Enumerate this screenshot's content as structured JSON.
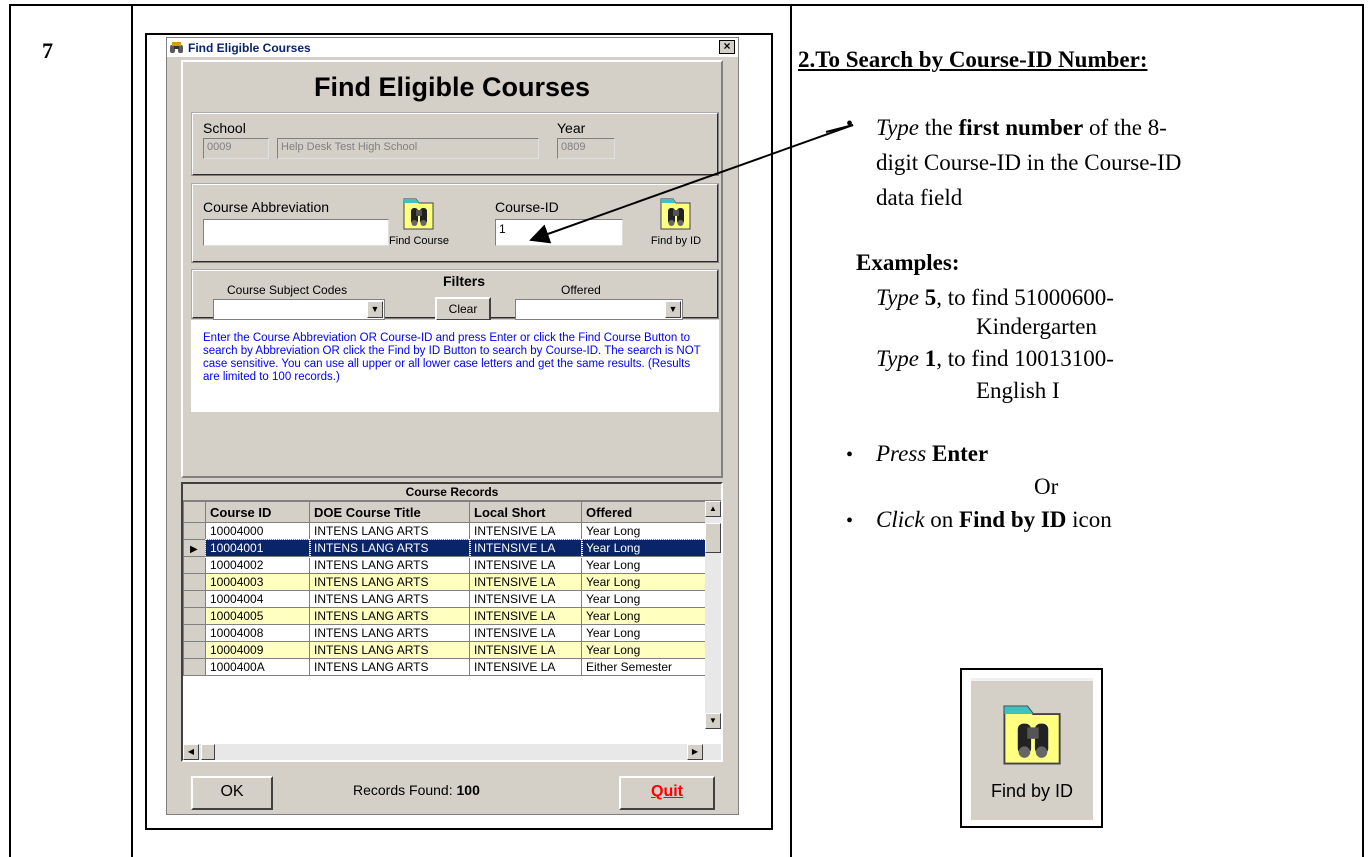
{
  "step": {
    "number": "7"
  },
  "window": {
    "title": "Find Eligible Courses",
    "close_label": "×",
    "heading": "Find Eligible Courses",
    "school_label": "School",
    "school_code": "0009",
    "school_name": "Help Desk Test High School",
    "year_label": "Year",
    "year_value": "0809",
    "course_abbrev_label": "Course Abbreviation",
    "course_abbrev_value": "",
    "find_course_label": "Find Course",
    "course_id_label": "Course-ID",
    "course_id_value": "1",
    "find_by_id_label": "Find by ID",
    "filters_label": "Filters",
    "subject_codes_label": "Course Subject Codes",
    "offered_label": "Offered",
    "clear_label": "Clear",
    "help_text": "Enter the Course Abbreviation OR Course-ID and press Enter or click the Find Course Button to search by Abbreviation OR click the Find by ID Button to search by Course-ID.  The search is NOT case sensitive. You can use all upper or all lower case letters and get the same results. (Results are limited to 100 records.)",
    "grid_caption": "Course Records",
    "columns": [
      "Course ID",
      "DOE Course Title",
      "Local Short",
      "Offered"
    ],
    "rows": [
      {
        "id": "10004000",
        "title": "INTENS LANG ARTS",
        "short": "INTENSIVE LA",
        "offered": "Year Long",
        "style": "white"
      },
      {
        "id": "10004001",
        "title": "INTENS LANG ARTS",
        "short": "INTENSIVE LA",
        "offered": "Year Long",
        "style": "active"
      },
      {
        "id": "10004002",
        "title": "INTENS LANG ARTS",
        "short": "INTENSIVE LA",
        "offered": "Year Long",
        "style": "white"
      },
      {
        "id": "10004003",
        "title": "INTENS LANG ARTS",
        "short": "INTENSIVE LA",
        "offered": "Year Long",
        "style": "yellow"
      },
      {
        "id": "10004004",
        "title": "INTENS LANG ARTS",
        "short": "INTENSIVE LA",
        "offered": "Year Long",
        "style": "white"
      },
      {
        "id": "10004005",
        "title": "INTENS LANG ARTS",
        "short": "INTENSIVE LA",
        "offered": "Year Long",
        "style": "yellow"
      },
      {
        "id": "10004008",
        "title": "INTENS LANG ARTS",
        "short": "INTENSIVE LA",
        "offered": "Year Long",
        "style": "white"
      },
      {
        "id": "10004009",
        "title": "INTENS LANG ARTS",
        "short": "INTENSIVE LA",
        "offered": "Year Long",
        "style": "yellow"
      },
      {
        "id": "1000400A",
        "title": "INTENS LANG ARTS",
        "short": "INTENSIVE LA",
        "offered": "Either Semester",
        "style": "white"
      }
    ],
    "ok_label": "OK",
    "records_found_label": "Records Found:",
    "records_found_value": "100",
    "quit_label": "Quit"
  },
  "instructions": {
    "heading": "2.To Search by Course-ID Number:",
    "bullet1_type": "Type",
    "bullet1_the": " the ",
    "bullet1_first": "first number",
    "bullet1_line1_rest": " of the 8-",
    "bullet1_line2": "digit Course-ID in the Course-ID",
    "bullet1_line3": "data field",
    "examples_label": "Examples:",
    "ex1_type": "Type",
    "ex1_num": "5",
    "ex1_rest": ", to find 51000600-",
    "ex1_line2": "Kindergarten",
    "ex2_type": "Type",
    "ex2_num": "1",
    "ex2_rest": ", to find 10013100-",
    "ex2_line2": "English I",
    "bullet2_press": "Press",
    "bullet2_enter": "Enter",
    "or_label": "Or",
    "bullet3_click": "Click",
    "bullet3_on": " on ",
    "bullet3_find": "Find by ID",
    "bullet3_icon": " icon",
    "icon_label": "Find by ID",
    "bullet_char": "•"
  },
  "colors": {
    "selection": "#0a246a",
    "alt_row": "#ffffc0",
    "help_text": "#0000ff",
    "quit": "#ff0000"
  }
}
